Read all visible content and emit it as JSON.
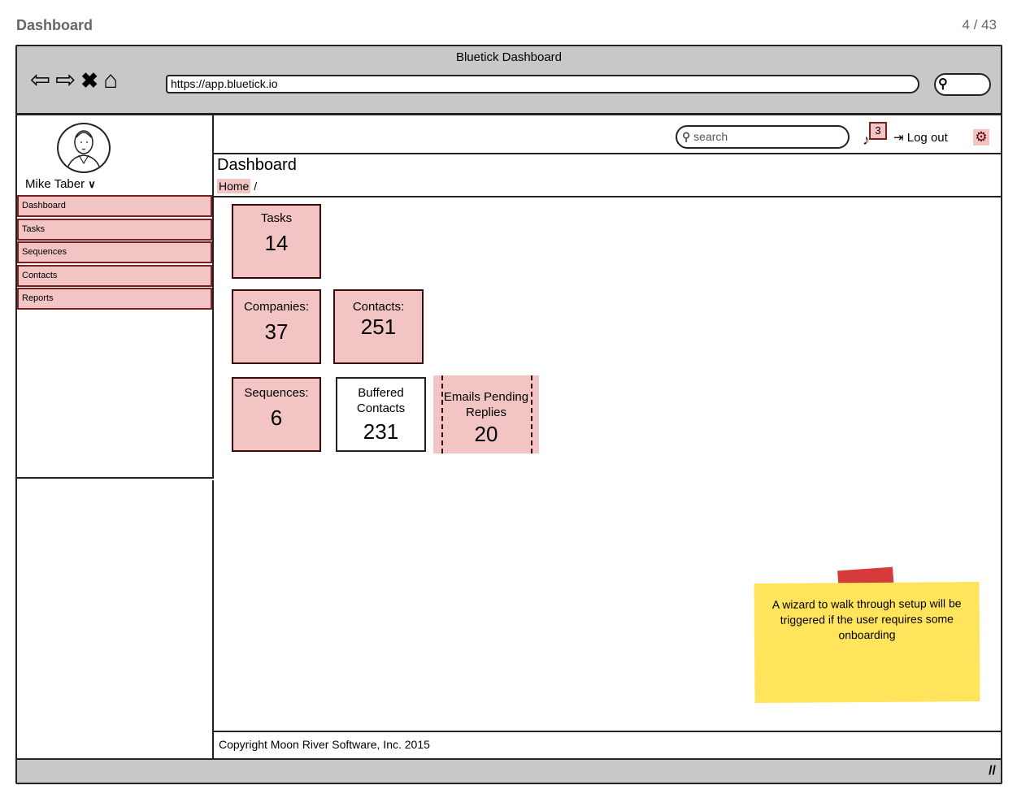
{
  "page": {
    "title": "Dashboard",
    "counter": "4 / 43"
  },
  "browser": {
    "window_title": "Bluetick Dashboard",
    "url": "https://app.bluetick.io",
    "nav_icons": [
      "back-arrow-icon",
      "forward-arrow-icon",
      "close-x-icon",
      "home-icon"
    ]
  },
  "sidebar": {
    "user_name": "Mike Taber",
    "items": [
      {
        "label": "Dashboard"
      },
      {
        "label": "Tasks"
      },
      {
        "label": "Sequences"
      },
      {
        "label": "Contacts"
      },
      {
        "label": "Reports"
      }
    ]
  },
  "topbar": {
    "search_placeholder": "search",
    "notification_count": "3",
    "logout_label": "Log out"
  },
  "header": {
    "title": "Dashboard",
    "breadcrumb_home": "Home",
    "breadcrumb_sep": "/"
  },
  "cards": [
    {
      "label": "Tasks",
      "value": "14"
    },
    {
      "label": "Companies:",
      "value": "37"
    },
    {
      "label": "Contacts:",
      "value": "251"
    },
    {
      "label": "Sequences:",
      "value": "6"
    },
    {
      "label_line1": "Buffered",
      "label_line2": "Contacts",
      "value": "231"
    },
    {
      "label_line1": "Emails Pending",
      "label_line2": "Replies",
      "value": "20"
    }
  ],
  "note": {
    "text": "A wizard to walk through setup will be triggered if the user requires some onboarding"
  },
  "footer": {
    "text": "Copyright Moon River Software, Inc. 2015"
  },
  "colors": {
    "accent_fill": "#f2c4c3",
    "accent_border": "#7a1f1f",
    "chrome": "#c8c8c8",
    "sticky": "#ffe45c",
    "tape": "#d63a3a"
  }
}
